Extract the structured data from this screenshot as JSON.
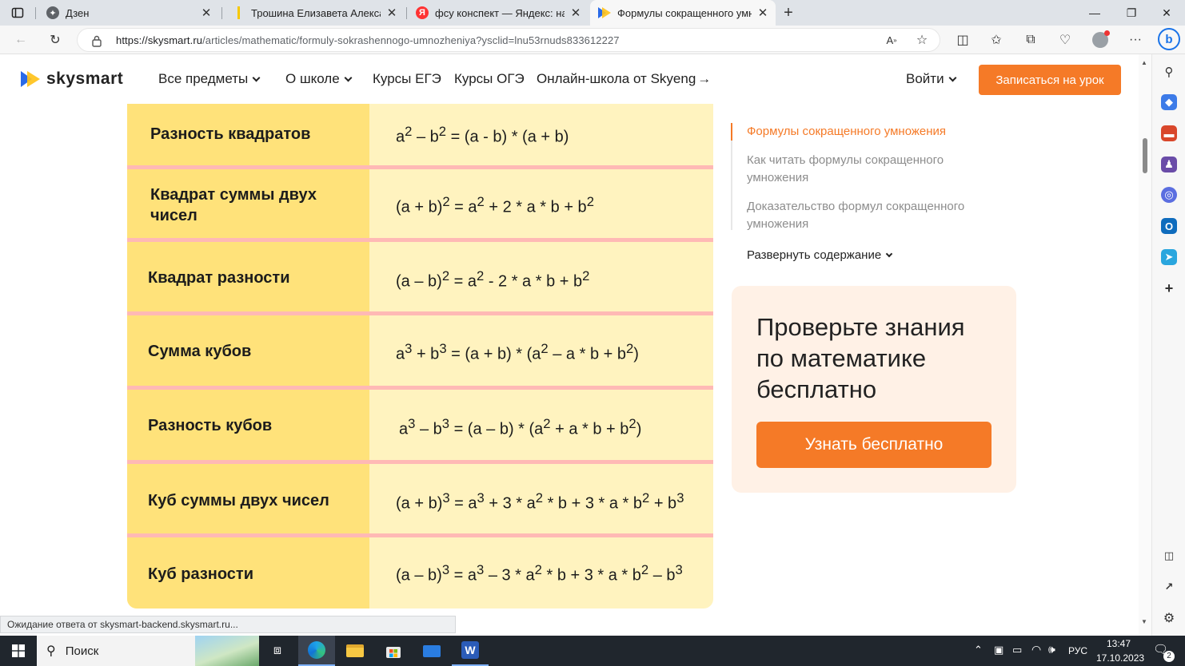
{
  "browser": {
    "tabs": [
      {
        "title": "Дзен",
        "active": false
      },
      {
        "title": "Трошина Елизавета Александро",
        "active": false
      },
      {
        "title": "фсу конспект — Яндекс: нашлос",
        "active": false
      },
      {
        "title": "Формулы сокращенного умнож",
        "active": true
      }
    ],
    "url_domain": "https://skysmart.ru",
    "url_path": "/articles/mathematic/formuly-sokrashennogo-umnozheniya?ysclid=lnu53rnuds833612227"
  },
  "site": {
    "logo_text": "skysmart",
    "nav": {
      "subjects": "Все предметы",
      "about": "О школе",
      "ege": "Курсы ЕГЭ",
      "oge": "Курсы ОГЭ",
      "online": "Онлайн-школа от Skyeng",
      "online_arrow": "→",
      "login": "Войти",
      "cta": "Записаться на урок"
    }
  },
  "formulas": [
    {
      "name": "Разность квадратов"
    },
    {
      "name": "Квадрат суммы двух чисел"
    },
    {
      "name": "Квадрат разности"
    },
    {
      "name": "Сумма кубов"
    },
    {
      "name": "Разность кубов"
    },
    {
      "name": "Куб суммы двух чисел"
    },
    {
      "name": "Куб разности"
    }
  ],
  "toc": {
    "items": [
      "Формулы сокращенного умножения",
      "Как читать формулы сокращенного умножения",
      "Доказательство формул сокращенного умножения"
    ],
    "expand": "Развернуть содержание"
  },
  "promo": {
    "title": "Проверьте знания по математике бесплатно",
    "button": "Узнать бесплатно"
  },
  "status": "Ожидание ответа от skysmart-backend.skysmart.ru...",
  "taskbar": {
    "search": "Поиск",
    "lang": "РУС",
    "time": "13:47",
    "date": "17.10.2023",
    "notifications": "2"
  }
}
